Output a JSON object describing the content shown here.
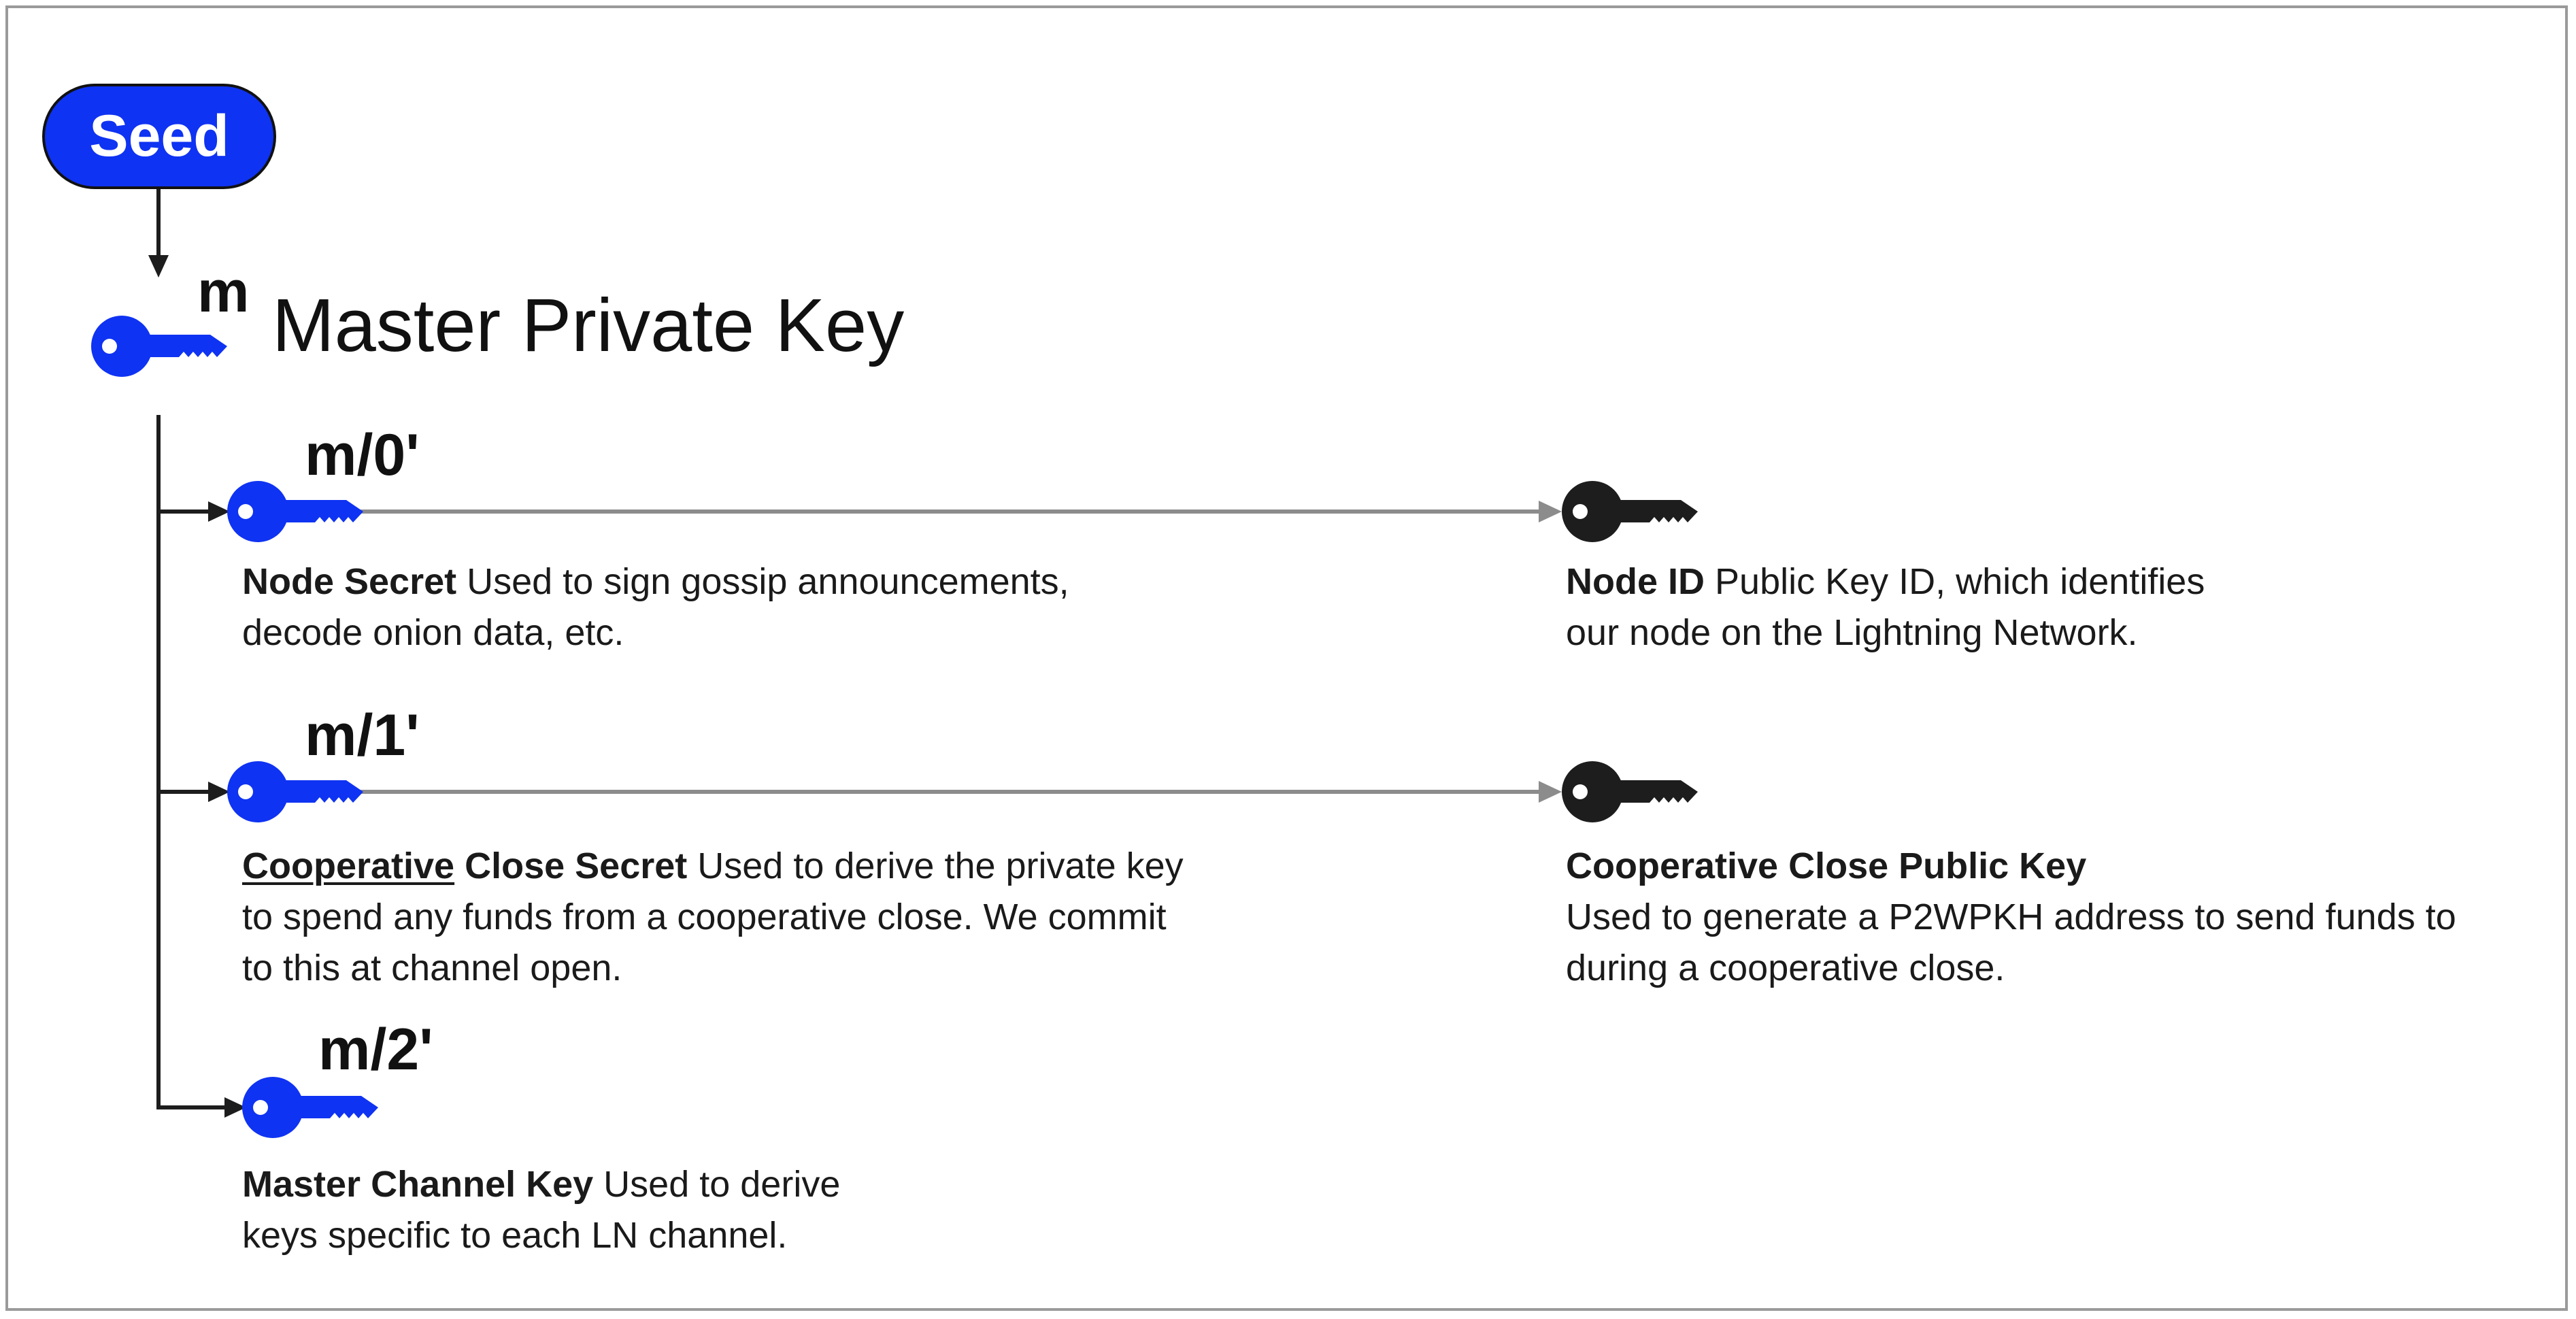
{
  "seed": {
    "label": "Seed"
  },
  "master": {
    "path": "m",
    "title": "Master Private Key"
  },
  "colors": {
    "accent": "#0f33f2",
    "dark": "#1d1d1d",
    "arrow_gray": "#8c8c8c",
    "frame": "#9a9a9a"
  },
  "branches": [
    {
      "path": "m/0'",
      "private": {
        "name": "Node Secret",
        "lines": [
          " Used to sign gossip announcements,",
          "decode onion data, etc."
        ]
      },
      "public": {
        "name": "Node ID",
        "lines": [
          " Public Key ID, which identifies",
          "our node on the Lightning Network."
        ]
      }
    },
    {
      "path": "m/1'",
      "private": {
        "name_underlined": "Cooperative",
        "name_rest": " Close Secret",
        "lines": [
          " Used to derive the private key",
          "to spend any funds from a cooperative close. We commit",
          "to this at channel open."
        ]
      },
      "public": {
        "name": "Cooperative Close Public Key",
        "lines": [
          "Used to generate a P2WPKH address to send funds to",
          "during a cooperative close."
        ]
      }
    },
    {
      "path": "m/2'",
      "private": {
        "name": "Master Channel Key",
        "lines": [
          " Used to derive",
          "keys specific to each LN channel."
        ]
      }
    }
  ]
}
